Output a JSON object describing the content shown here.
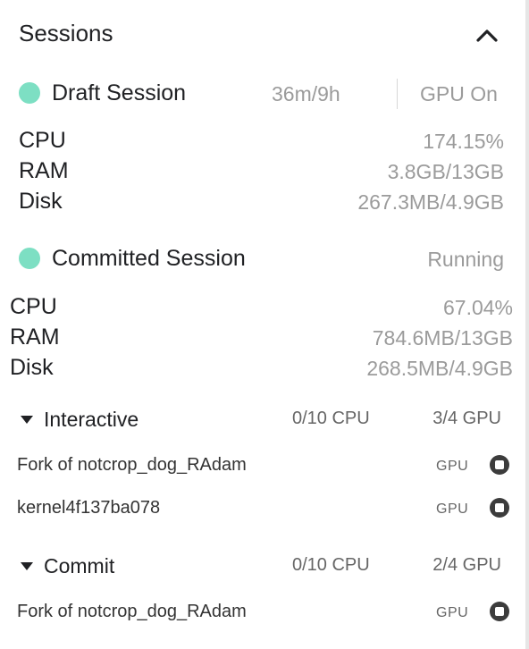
{
  "panel": {
    "title": "Sessions"
  },
  "draft": {
    "name": "Draft Session",
    "time": "36m/9h",
    "gpu_status": "GPU On",
    "metrics": [
      {
        "label": "CPU",
        "value": "174.15%"
      },
      {
        "label": "RAM",
        "value": "3.8GB/13GB"
      },
      {
        "label": "Disk",
        "value": "267.3MB/4.9GB"
      }
    ]
  },
  "committed": {
    "name": "Committed Session",
    "status": "Running",
    "metrics": [
      {
        "label": "CPU",
        "value": "67.04%"
      },
      {
        "label": "RAM",
        "value": "784.6MB/13GB"
      },
      {
        "label": "Disk",
        "value": "268.5MB/4.9GB"
      }
    ]
  },
  "interactive": {
    "label": "Interactive",
    "cpu": "0/10 CPU",
    "gpu": "3/4 GPU",
    "items": [
      {
        "name": "Fork of notcrop_dog_RAdam",
        "tag": "GPU"
      },
      {
        "name": "kernel4f137ba078",
        "tag": "GPU"
      }
    ]
  },
  "commit": {
    "label": "Commit",
    "cpu": "0/10 CPU",
    "gpu": "2/4 GPU",
    "items": [
      {
        "name": "Fork of notcrop_dog_RAdam",
        "tag": "GPU"
      }
    ]
  },
  "colors": {
    "status_dot": "#7ddfc3",
    "muted_text": "#9b9b9b"
  }
}
